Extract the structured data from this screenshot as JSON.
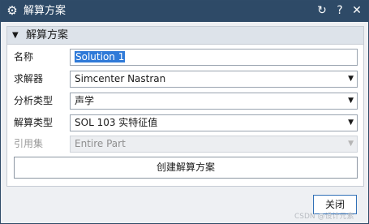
{
  "window": {
    "title": "解算方案",
    "icons": {
      "app": "gear-icon",
      "reset": "reset-icon",
      "help": "help-icon",
      "close": "close-icon"
    }
  },
  "group": {
    "title": "解算方案",
    "expanded": true
  },
  "fields": {
    "name": {
      "label": "名称",
      "value": "Solution 1"
    },
    "solver": {
      "label": "求解器",
      "value": "Simcenter Nastran"
    },
    "analysis_type": {
      "label": "分析类型",
      "value": "声学"
    },
    "solution_type": {
      "label": "解算类型",
      "value": "SOL 103 实特征值"
    },
    "reference_set": {
      "label": "引用集",
      "value": "Entire Part",
      "disabled": true
    }
  },
  "buttons": {
    "create": "创建解算方案",
    "close": "关闭"
  },
  "watermark": "CSDN @设计元素",
  "colors": {
    "titlebar": "#2e4a67",
    "selection": "#2f7ad8",
    "close_button_border": "#2f6fb6"
  }
}
